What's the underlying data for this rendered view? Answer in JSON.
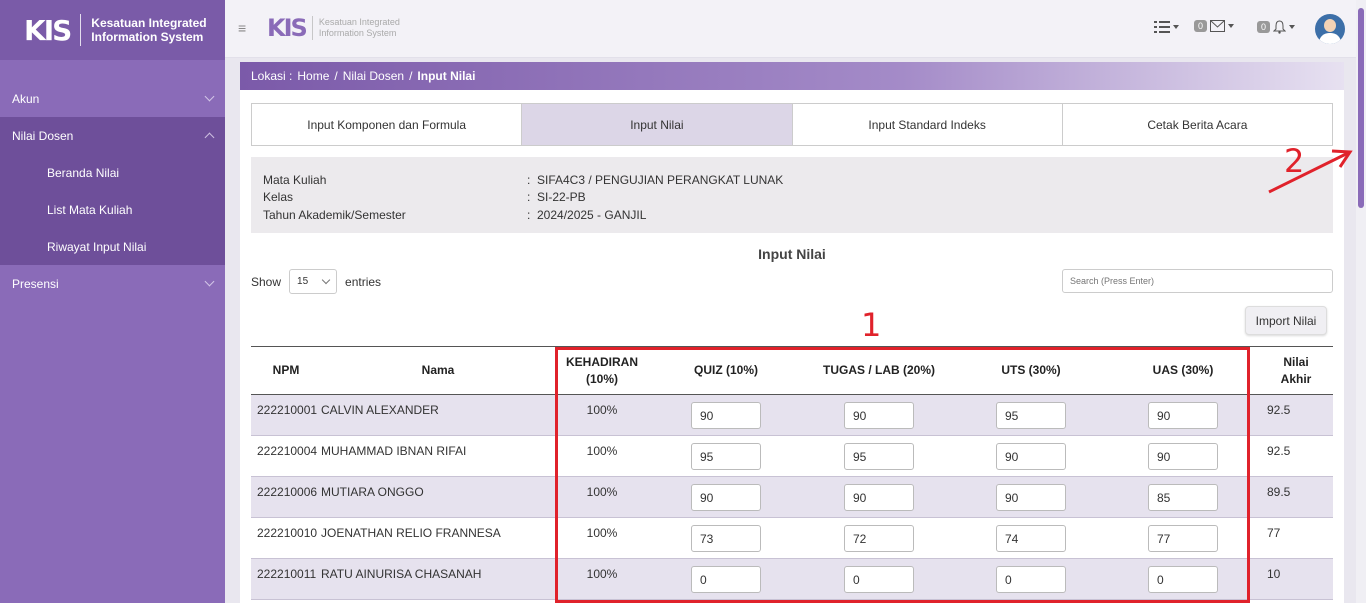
{
  "sidebar": {
    "logo_mark": "KIS",
    "logo_line1": "Kesatuan Integrated",
    "logo_line2": "Information System",
    "items": [
      {
        "label": "Akun"
      },
      {
        "label": "Nilai Dosen"
      },
      {
        "label": "Beranda Nilai"
      },
      {
        "label": "List Mata Kuliah"
      },
      {
        "label": "Riwayat Input Nilai"
      },
      {
        "label": "Presensi"
      }
    ]
  },
  "topbar": {
    "hamburger": "≡",
    "logo_mark": "KIS",
    "logo_line1": "Kesatuan Integrated",
    "logo_line2": "Information System",
    "mail_count": "0",
    "notif_count": "0"
  },
  "breadcrumb": {
    "prefix": "Lokasi :",
    "home": "Home",
    "sep": "/",
    "parent": "Nilai Dosen",
    "current": "Input Nilai"
  },
  "tabs": [
    {
      "label": "Input Komponen dan Formula"
    },
    {
      "label": "Input Nilai"
    },
    {
      "label": "Input Standard Indeks"
    },
    {
      "label": "Cetak Berita Acara"
    }
  ],
  "info": {
    "rows": [
      {
        "label": "Mata Kuliah",
        "colon": ":",
        "value": "SIFA4C3 / PENGUJIAN PERANGKAT LUNAK"
      },
      {
        "label": "Kelas",
        "colon": ":",
        "value": "SI-22-PB"
      },
      {
        "label": "Tahun Akademik/Semester",
        "colon": ":",
        "value": "2024/2025 - GANJIL"
      }
    ]
  },
  "section_title": "Input Nilai",
  "controls": {
    "show_label": "Show",
    "entries_value": "15",
    "entries_label": "entries",
    "search_placeholder": "Search (Press Enter)",
    "import_label": "Import Nilai"
  },
  "table": {
    "headers": {
      "npm": "NPM",
      "nama": "Nama",
      "kehadiran_1": "KEHADIRAN",
      "kehadiran_2": "(10%)",
      "quiz": "QUIZ (10%)",
      "tugas": "TUGAS / LAB (20%)",
      "uts": "UTS (30%)",
      "uas": "UAS (30%)",
      "akhir_1": "Nilai",
      "akhir_2": "Akhir"
    },
    "rows": [
      {
        "npm": "222210001",
        "nama": "CALVIN ALEXANDER",
        "kehadiran": "100%",
        "quiz": "90",
        "tugas": "90",
        "uts": "95",
        "uas": "90",
        "akhir": "92.5"
      },
      {
        "npm": "222210004",
        "nama": "MUHAMMAD IBNAN RIFAI",
        "kehadiran": "100%",
        "quiz": "95",
        "tugas": "95",
        "uts": "90",
        "uas": "90",
        "akhir": "92.5"
      },
      {
        "npm": "222210006",
        "nama": "MUTIARA ONGGO",
        "kehadiran": "100%",
        "quiz": "90",
        "tugas": "90",
        "uts": "90",
        "uas": "85",
        "akhir": "89.5"
      },
      {
        "npm": "222210010",
        "nama": "JOENATHAN RELIO FRANNESA",
        "kehadiran": "100%",
        "quiz": "73",
        "tugas": "72",
        "uts": "74",
        "uas": "77",
        "akhir": "77"
      },
      {
        "npm": "222210011",
        "nama": "RATU AINURISA CHASANAH",
        "kehadiran": "100%",
        "quiz": "0",
        "tugas": "0",
        "uts": "0",
        "uas": "0",
        "akhir": "10"
      }
    ]
  },
  "annotations": {
    "label_1": "1",
    "label_2": "2",
    "color": "#e0222b"
  },
  "colors": {
    "sidebar": "#8a6bb8",
    "accent": "#7b5aa9",
    "active_tab": "#dcd6e7"
  }
}
